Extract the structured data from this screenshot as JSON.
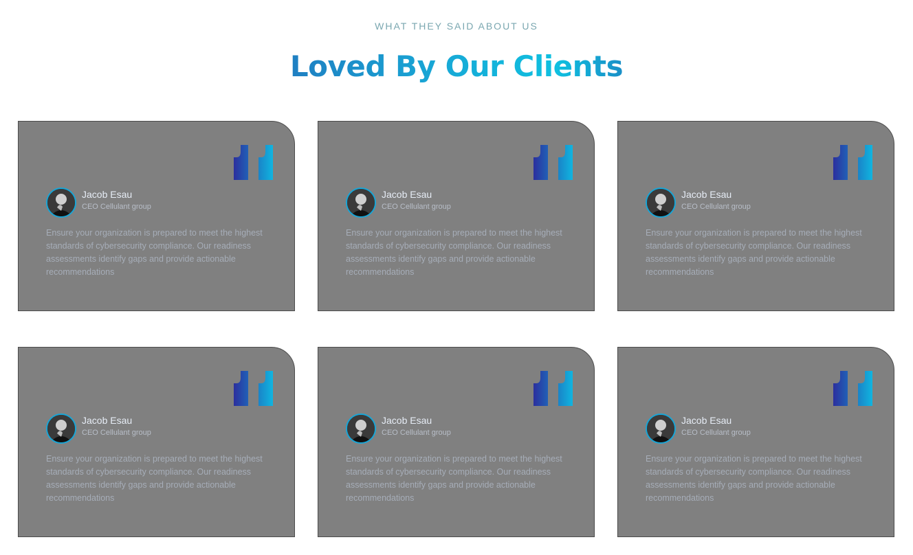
{
  "header": {
    "eyebrow": "WHAT THEY SAID ABOUT US",
    "title": "Loved By Our Clients"
  },
  "colors": {
    "title_gradient": [
      "#1f7fc2",
      "#0fc0e0"
    ],
    "quote_gradient": [
      "#2b2f9e",
      "#10b5e0"
    ],
    "card_background": "#808080",
    "avatar_ring": "#16a6d8"
  },
  "testimonials": [
    {
      "name": "Jacob Esau",
      "role": "CEO Cellulant group",
      "text": "Ensure your organization is prepared to meet the highest standards of cybersecurity compliance. Our readiness assessments identify gaps and provide actionable recommendations",
      "icon": "quote-icon"
    },
    {
      "name": "Jacob Esau",
      "role": "CEO Cellulant group",
      "text": "Ensure your organization is prepared to meet the highest standards of cybersecurity compliance. Our readiness assessments identify gaps and provide actionable recommendations",
      "icon": "quote-icon"
    },
    {
      "name": "Jacob Esau",
      "role": "CEO Cellulant group",
      "text": "Ensure your organization is prepared to meet the highest standards of cybersecurity compliance. Our readiness assessments identify gaps and provide actionable recommendations",
      "icon": "quote-icon"
    },
    {
      "name": "Jacob Esau",
      "role": "CEO Cellulant group",
      "text": "Ensure your organization is prepared to meet the highest standards of cybersecurity compliance. Our readiness assessments identify gaps and provide actionable recommendations",
      "icon": "quote-icon"
    },
    {
      "name": "Jacob Esau",
      "role": "CEO Cellulant group",
      "text": "Ensure your organization is prepared to meet the highest standards of cybersecurity compliance. Our readiness assessments identify gaps and provide actionable recommendations",
      "icon": "quote-icon"
    },
    {
      "name": "Jacob Esau",
      "role": "CEO Cellulant group",
      "text": "Ensure your organization is prepared to meet the highest standards of cybersecurity compliance. Our readiness assessments identify gaps and provide actionable recommendations",
      "icon": "quote-icon"
    }
  ]
}
